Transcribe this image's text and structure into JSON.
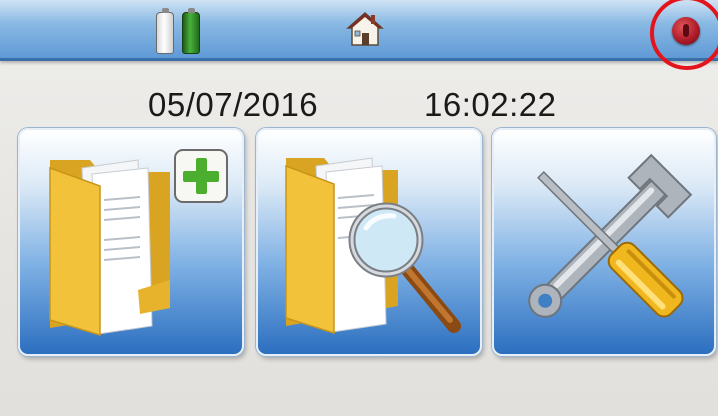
{
  "status_bar": {
    "batteries": [
      {
        "icon": "battery-empty-icon",
        "color": "#e6e6e6"
      },
      {
        "icon": "battery-full-icon",
        "color": "#3a9a2e"
      }
    ],
    "home_icon": "home-icon",
    "power_icon": "power-icon",
    "power_color": "#b01c2a",
    "highlight_color": "#e3141c"
  },
  "datetime": {
    "date": "05/07/2016",
    "time": "16:02:22"
  },
  "tiles": [
    {
      "id": "new-record",
      "icon": "folder-plus-icon"
    },
    {
      "id": "search-records",
      "icon": "folder-search-icon"
    },
    {
      "id": "settings",
      "icon": "tools-icon"
    }
  ],
  "colors": {
    "tile_gradient_top": "#ffffff",
    "tile_gradient_bottom": "#2c6fc0",
    "folder_yellow": "#f2c33a",
    "plus_green": "#4cae2f"
  }
}
